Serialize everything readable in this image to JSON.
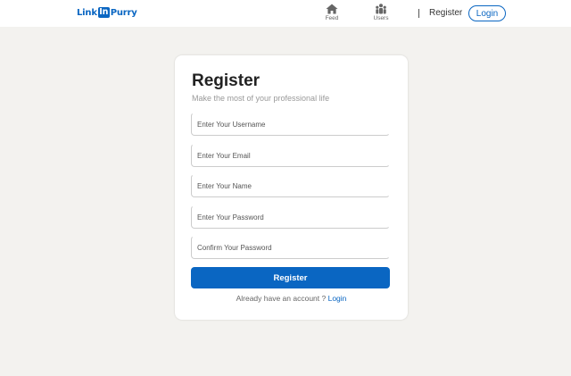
{
  "nav": {
    "logo_left": "Link",
    "logo_box": "In",
    "logo_right": "Purry",
    "items": [
      {
        "label": "Feed",
        "icon": "home-icon"
      },
      {
        "label": "Users",
        "icon": "users-icon"
      }
    ],
    "register_label": "Register",
    "login_label": "Login"
  },
  "form": {
    "title": "Register",
    "subtitle": "Make the most of your professional life",
    "fields": [
      {
        "placeholder": "Enter Your Username",
        "value": ""
      },
      {
        "placeholder": "Enter Your Email",
        "value": ""
      },
      {
        "placeholder": "Enter Your Name",
        "value": ""
      },
      {
        "placeholder": "Enter Your Password",
        "value": ""
      },
      {
        "placeholder": "Confirm Your Password",
        "value": ""
      }
    ],
    "submit_label": "Register",
    "footer_text": "Already have an account ? ",
    "footer_link": "Login"
  },
  "colors": {
    "brand": "#0a66c2",
    "background": "#f3f2ef",
    "card": "#ffffff"
  }
}
